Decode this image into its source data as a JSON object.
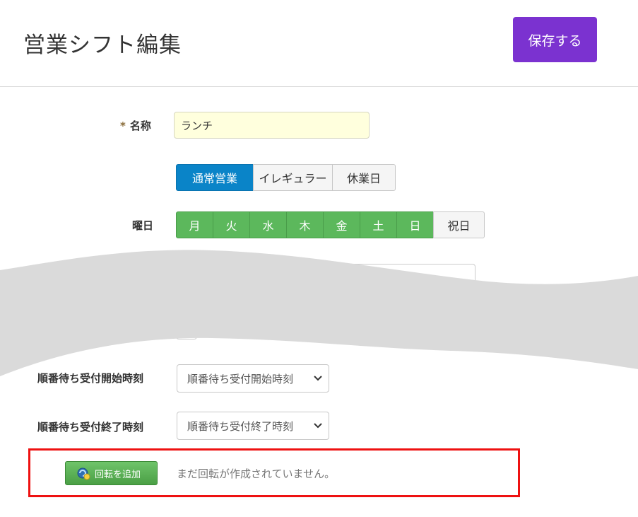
{
  "header": {
    "title": "営業シフト編集",
    "save_label": "保存する"
  },
  "form": {
    "name_label": "名称",
    "required_mark": "*",
    "name_value": "ランチ",
    "type_options": [
      "通常営業",
      "イレギュラー",
      "休業日"
    ],
    "type_selected": "通常営業",
    "weekday_label": "曜日",
    "weekdays": [
      "月",
      "火",
      "水",
      "木",
      "金",
      "土",
      "日"
    ],
    "holiday_label": "祝日",
    "queue_start_label": "順番待ち受付開始時刻",
    "queue_start_value": "順番待ち受付開始時刻",
    "queue_end_label": "順番待ち受付終了時刻",
    "queue_end_value": "順番待ち受付終了時刻"
  },
  "rotation": {
    "add_button_label": "回転を追加",
    "empty_message": "まだ回転が作成されていません。"
  },
  "colors": {
    "save_button": "#7b32d0",
    "name_input_bg": "#ffffdd",
    "type_active": "#0a84c8",
    "weekday_active": "#5cb85c",
    "highlight": "#ee1111"
  }
}
